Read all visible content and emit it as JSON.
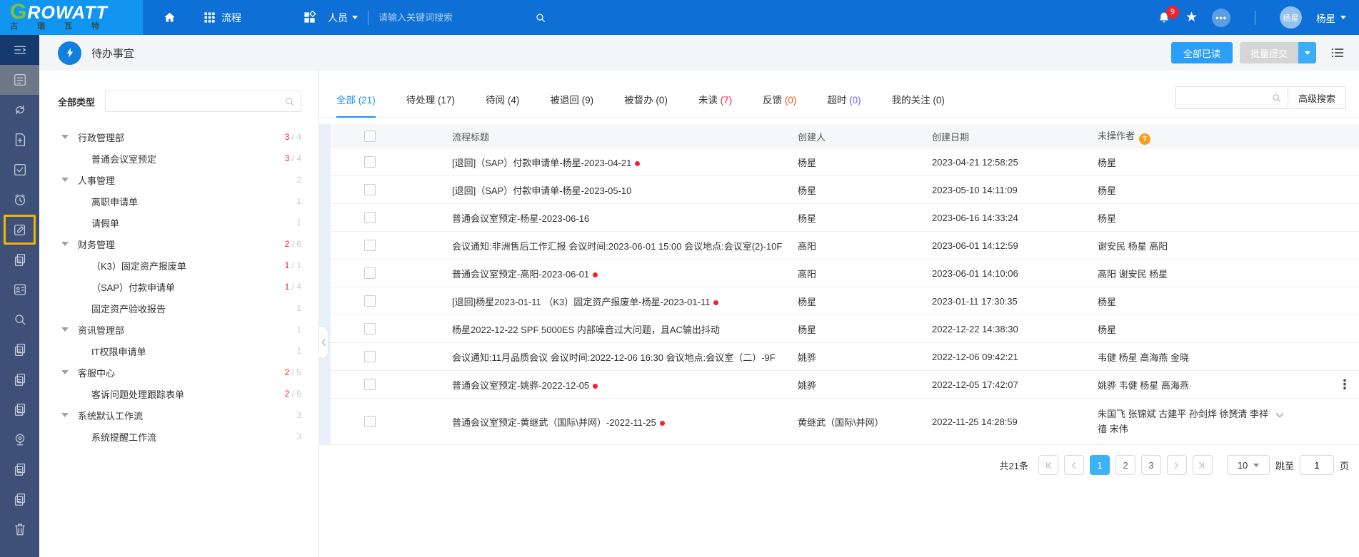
{
  "topbar": {
    "logo": {
      "g": "G",
      "rest": "ROWATT",
      "cn": "古 瑞 瓦 特"
    },
    "nav": {
      "process_label": "流程",
      "people_label": "人员",
      "search_placeholder": "请输入关键词搜索"
    },
    "user": {
      "badge_count": "9",
      "avatar_text": "杨星",
      "name": "杨星"
    }
  },
  "sidebar": {
    "icons": [
      {
        "name": "menu-collapse-icon",
        "type": "menu",
        "variant": "top"
      },
      {
        "name": "todo-list-icon",
        "type": "doc",
        "variant": "active"
      },
      {
        "name": "process-sync-icon",
        "type": "sync"
      },
      {
        "name": "new-form-icon",
        "type": "fileplus"
      },
      {
        "name": "approved-icon",
        "type": "check"
      },
      {
        "name": "pending-clock-icon",
        "type": "clock"
      },
      {
        "name": "draft-edit-icon",
        "type": "edit",
        "variant": "highlight"
      },
      {
        "name": "copies-icon",
        "type": "copy"
      },
      {
        "name": "contacts-card-icon",
        "type": "contact"
      },
      {
        "name": "search-icon",
        "type": "search"
      },
      {
        "name": "documents-icon",
        "type": "copy"
      },
      {
        "name": "documents-2-icon",
        "type": "copy"
      },
      {
        "name": "documents-3-icon",
        "type": "copy"
      },
      {
        "name": "monitor-cam-icon",
        "type": "webcam"
      },
      {
        "name": "documents-4-icon",
        "type": "copy"
      },
      {
        "name": "documents-5-icon",
        "type": "copy"
      },
      {
        "name": "trash-icon",
        "type": "trash"
      }
    ]
  },
  "page": {
    "title": "待办事宜",
    "read_all_label": "全部已读",
    "batch_submit_label": "批量提交"
  },
  "tree": {
    "filter_label": "全部类型",
    "items": [
      {
        "label": "行政管理部",
        "child": false,
        "active": "3",
        "total": "4"
      },
      {
        "label": "普通会议室预定",
        "child": true,
        "active": "3",
        "total": "4"
      },
      {
        "label": "人事管理",
        "child": false,
        "total": "2"
      },
      {
        "label": "离职申请单",
        "child": true,
        "total": "1"
      },
      {
        "label": "请假单",
        "child": true,
        "total": "1"
      },
      {
        "label": "财务管理",
        "child": false,
        "active": "2",
        "total": "6"
      },
      {
        "label": "（K3）固定资产报废单",
        "child": true,
        "active": "1",
        "total": "1"
      },
      {
        "label": "（SAP）付款申请单",
        "child": true,
        "active": "1",
        "total": "4"
      },
      {
        "label": "固定资产验收报告",
        "child": true,
        "total": "1"
      },
      {
        "label": "资讯管理部",
        "child": false,
        "total": "1"
      },
      {
        "label": "IT权限申请单",
        "child": true,
        "total": "1"
      },
      {
        "label": "客服中心",
        "child": false,
        "active": "2",
        "total": "5"
      },
      {
        "label": "客诉问题处理跟踪表单",
        "child": true,
        "active": "2",
        "total": "5"
      },
      {
        "label": "系统默认工作流",
        "child": false,
        "total": "3"
      },
      {
        "label": "系统提醒工作流",
        "child": true,
        "total": "3"
      }
    ]
  },
  "tabs": [
    {
      "label": "全部",
      "count": "21",
      "active": true
    },
    {
      "label": "待处理",
      "count": "17"
    },
    {
      "label": "待阅",
      "count": "4"
    },
    {
      "label": "被退回",
      "count": "9"
    },
    {
      "label": "被督办",
      "count": "0"
    },
    {
      "label": "未读",
      "count": "7",
      "count_color": "red"
    },
    {
      "label": "反馈",
      "count": "0",
      "count_color": "orange"
    },
    {
      "label": "超时",
      "count": "0",
      "count_color": "purple"
    },
    {
      "label": "我的关注",
      "count": "0"
    }
  ],
  "search": {
    "advanced_label": "高级搜索"
  },
  "table": {
    "headers": {
      "title": "流程标题",
      "creator": "创建人",
      "date": "创建日期",
      "pending": "未操作者"
    },
    "rows": [
      {
        "title": "[退回]（SAP）付款申请单-杨星-2023-04-21",
        "dot": true,
        "creator": "杨星",
        "date": "2023-04-21 12:58:25",
        "pending": "杨星"
      },
      {
        "title": "[退回]（SAP）付款申请单-杨星-2023-05-10",
        "dot": false,
        "creator": "杨星",
        "date": "2023-05-10 14:11:09",
        "pending": "杨星"
      },
      {
        "title": "普通会议室预定-杨星-2023-06-16",
        "dot": false,
        "creator": "杨星",
        "date": "2023-06-16 14:33:24",
        "pending": "杨星"
      },
      {
        "title": "会议通知:非洲售后工作汇报 会议时间:2023-06-01 15:00 会议地点:会议室(2)-10F",
        "dot": false,
        "creator": "高阳",
        "date": "2023-06-01 14:12:59",
        "pending": "谢安民 杨星 高阳"
      },
      {
        "title": "普通会议室预定-高阳-2023-06-01",
        "dot": true,
        "creator": "高阳",
        "date": "2023-06-01 14:10:06",
        "pending": "高阳 谢安民 杨星"
      },
      {
        "title": "[退回]杨星2023-01-11 （K3）固定资产报废单-杨星-2023-01-11",
        "dot": true,
        "creator": "杨星",
        "date": "2023-01-11 17:30:35",
        "pending": "杨星"
      },
      {
        "title": "杨星2022-12-22 SPF 5000ES 内部噪音过大问题，且AC输出抖动",
        "dot": false,
        "creator": "杨星",
        "date": "2022-12-22 14:38:30",
        "pending": "杨星"
      },
      {
        "title": "会议通知:11月品质会议 会议时间:2022-12-06 16:30 会议地点:会议室（二）-9F",
        "dot": false,
        "creator": "姚骅",
        "date": "2022-12-06 09:42:21",
        "pending": "韦健 杨星 高海燕 金晓"
      },
      {
        "title": "普通会议室预定-姚骅-2022-12-05",
        "dot": true,
        "creator": "姚骅",
        "date": "2022-12-05 17:42:07",
        "pending": "姚骅 韦健 杨星 高海燕",
        "menu": true
      },
      {
        "title": "普通会议室预定-黄继武（国际\\并网）-2022-11-25",
        "dot": true,
        "creator": "黄继武（国际\\并网）",
        "date": "2022-11-25 14:28:59",
        "pending": "朱国飞 张锦斌 古建平 孙剑烨 徐赟清 李祥",
        "pending_line2": "禧 宋伟",
        "expand": true
      }
    ]
  },
  "pagination": {
    "total": "共21条",
    "pages": [
      "1",
      "2",
      "3"
    ],
    "current": "1",
    "page_size": "10",
    "jump_label": "跳至",
    "jump_value": "1",
    "page_suffix": "页"
  }
}
